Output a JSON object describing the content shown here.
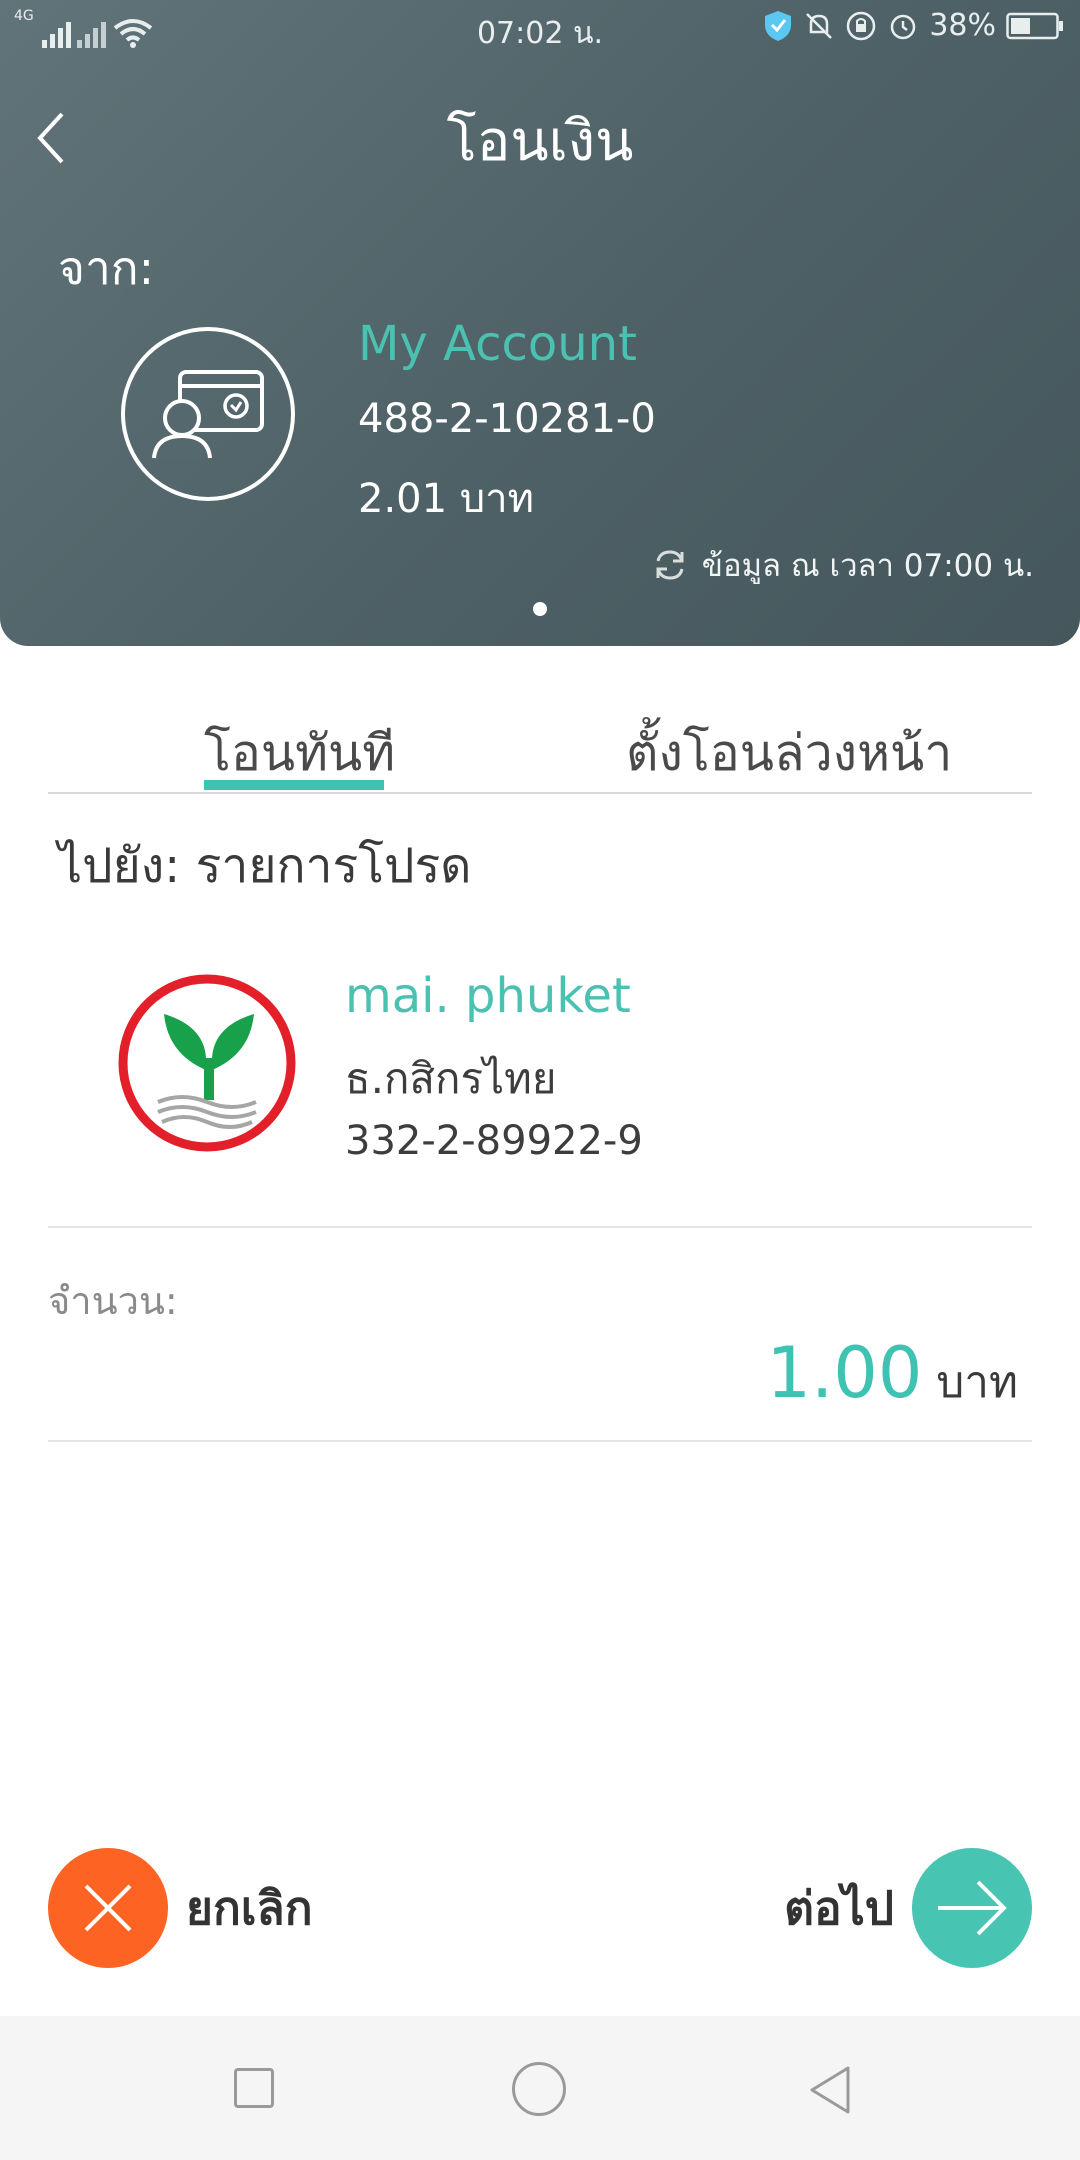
{
  "status_bar": {
    "network": "4G",
    "time": "07:02 น.",
    "battery": "38%"
  },
  "header": {
    "title": "โอนเงิน",
    "from_label": "จาก:",
    "account": {
      "name": "My Account",
      "number": "488-2-10281-0",
      "balance": "2.01 บาท"
    },
    "refresh_text": "ข้อมูล ณ เวลา 07:00 น."
  },
  "tabs": [
    {
      "label": "โอนทันที",
      "active": true
    },
    {
      "label": "ตั้งโอนล่วงหน้า",
      "active": false
    }
  ],
  "destination": {
    "label": "ไปยัง: รายการโปรด",
    "recipient_name": "mai. phuket",
    "bank_name": "ธ.กสิกรไทย",
    "account_number": "332-2-89922-9"
  },
  "amount": {
    "label": "จำนวน:",
    "value": "1.00",
    "unit": "บาท"
  },
  "actions": {
    "cancel_label": "ยกเลิก",
    "next_label": "ต่อไป"
  },
  "colors": {
    "accent": "#3ec2b1",
    "cancel": "#fd6424",
    "header_bg": "#52656a"
  },
  "icons": [
    "back-chevron-icon",
    "account-card-icon",
    "refresh-icon",
    "kbank-logo",
    "close-icon",
    "arrow-right-icon"
  ]
}
